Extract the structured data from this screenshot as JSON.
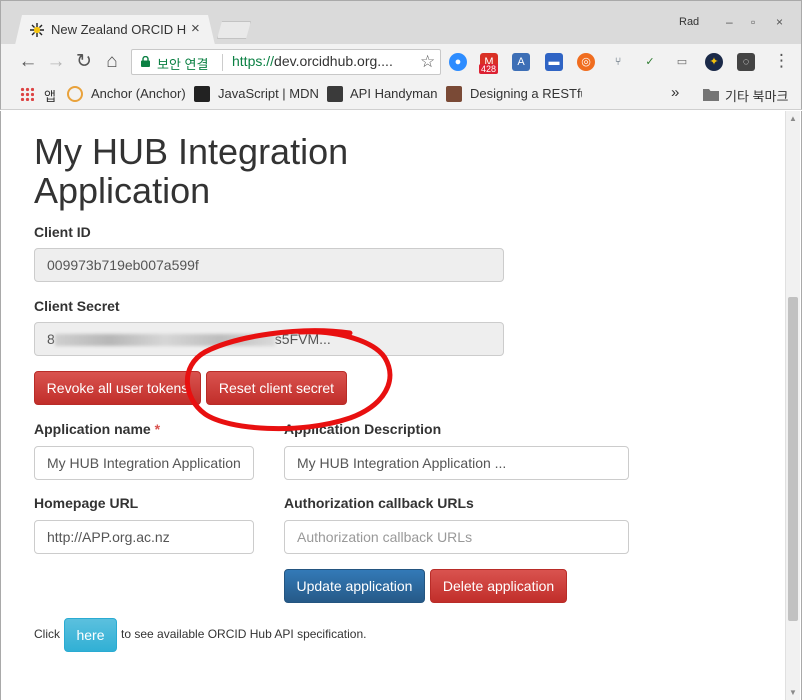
{
  "browser": {
    "tab_title": "New Zealand ORCID Hub",
    "tab_close_glyph": "×",
    "profile_name": "Rad",
    "window_controls": [
      "‒",
      "▫",
      "×"
    ],
    "nav": {
      "back": "←",
      "forward": "→",
      "reload": "↻",
      "home": "⌂"
    },
    "security_label": "보안 연결",
    "url_scheme": "https://",
    "url_rest": "dev.orcidhub.org....",
    "extension_badge": "428",
    "menu_glyph": "⋮",
    "bookmarks": {
      "apps_label": "앱",
      "items": [
        "Anchor (Anchor)",
        "JavaScript | MDN",
        "API Handyman",
        "Designing a RESTful"
      ],
      "overflow_glyph": "»",
      "other_label": "기타 북마크"
    }
  },
  "page": {
    "title": "My HUB Integration Application",
    "client_id": {
      "label": "Client ID",
      "value": "009973b719eb007a599f"
    },
    "client_secret": {
      "label": "Client Secret",
      "value_start": "8",
      "value_end": "s5FVM..."
    },
    "buttons": {
      "revoke": "Revoke all user tokens",
      "reset": "Reset client secret",
      "update": "Update application",
      "delete": "Delete application"
    },
    "app_name": {
      "label": "Application name",
      "required_marker": "*",
      "value": "My HUB Integration Application"
    },
    "app_description": {
      "label": "Application Description",
      "value": "My HUB Integration Application ..."
    },
    "homepage": {
      "label": "Homepage URL",
      "value": "http://APP.org.ac.nz"
    },
    "callbacks": {
      "label": "Authorization callback URLs",
      "placeholder": "Authorization callback URLs"
    },
    "footer": {
      "before": "Click",
      "link": "here",
      "after": "to see available ORCID Hub API specification."
    }
  },
  "colors": {
    "annotation_red": "#e81010",
    "danger": "#d9534f",
    "primary": "#337ab7",
    "info": "#5bc0de",
    "secure_green": "#0b8043"
  }
}
